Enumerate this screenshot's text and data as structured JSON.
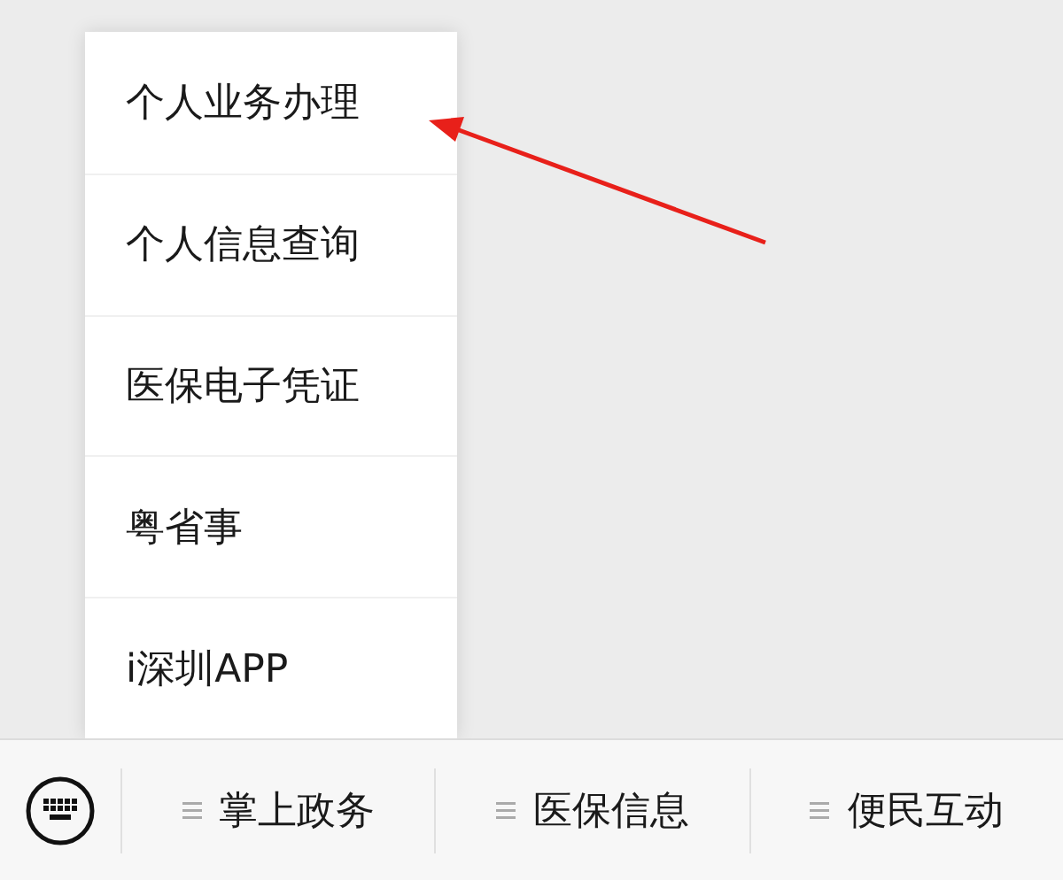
{
  "popup_menu": {
    "items": [
      {
        "label": "个人业务办理"
      },
      {
        "label": "个人信息查询"
      },
      {
        "label": "医保电子凭证"
      },
      {
        "label": "粤省事"
      },
      {
        "label": "i深圳APP"
      }
    ]
  },
  "annotation": {
    "kind": "arrow"
  },
  "bottom_menu": {
    "tabs": [
      {
        "label": "掌上政务"
      },
      {
        "label": "医保信息"
      },
      {
        "label": "便民互动"
      }
    ]
  }
}
